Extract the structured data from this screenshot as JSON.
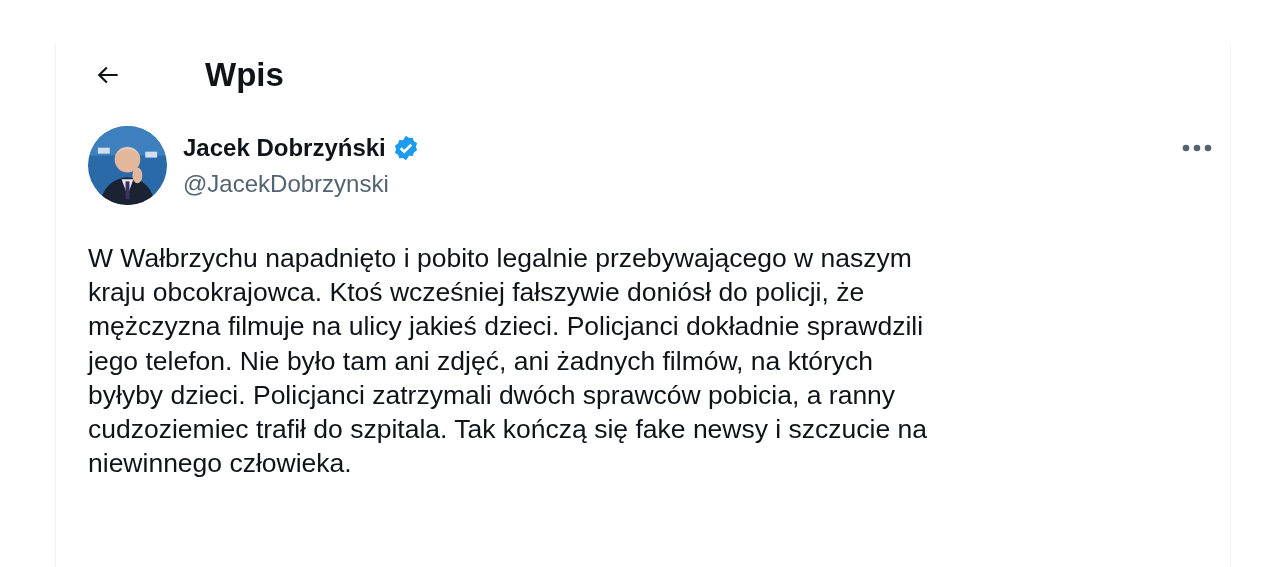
{
  "header": {
    "title": "Wpis"
  },
  "post": {
    "author": {
      "name": "Jacek Dobrzyński",
      "verified": true,
      "handle": "@JacekDobrzynski"
    },
    "text_lines": [
      "W Wałbrzychu napadnięto i pobito legalnie przebywającego w naszym",
      "kraju obcokrajowca. Ktoś wcześniej fałszywie doniósł do policji, że",
      "mężczyzna filmuje na ulicy jakieś dzieci. Policjanci dokładnie sprawdzili",
      "jego telefon. Nie było tam ani zdjęć, ani żadnych filmów, na których",
      "byłyby dzieci. Policjanci zatrzymali dwóch sprawców pobicia, a ranny",
      "cudzoziemiec trafił do szpitala. Tak kończą się fake newsy i szczucie na",
      "niewinnego człowieka."
    ]
  }
}
